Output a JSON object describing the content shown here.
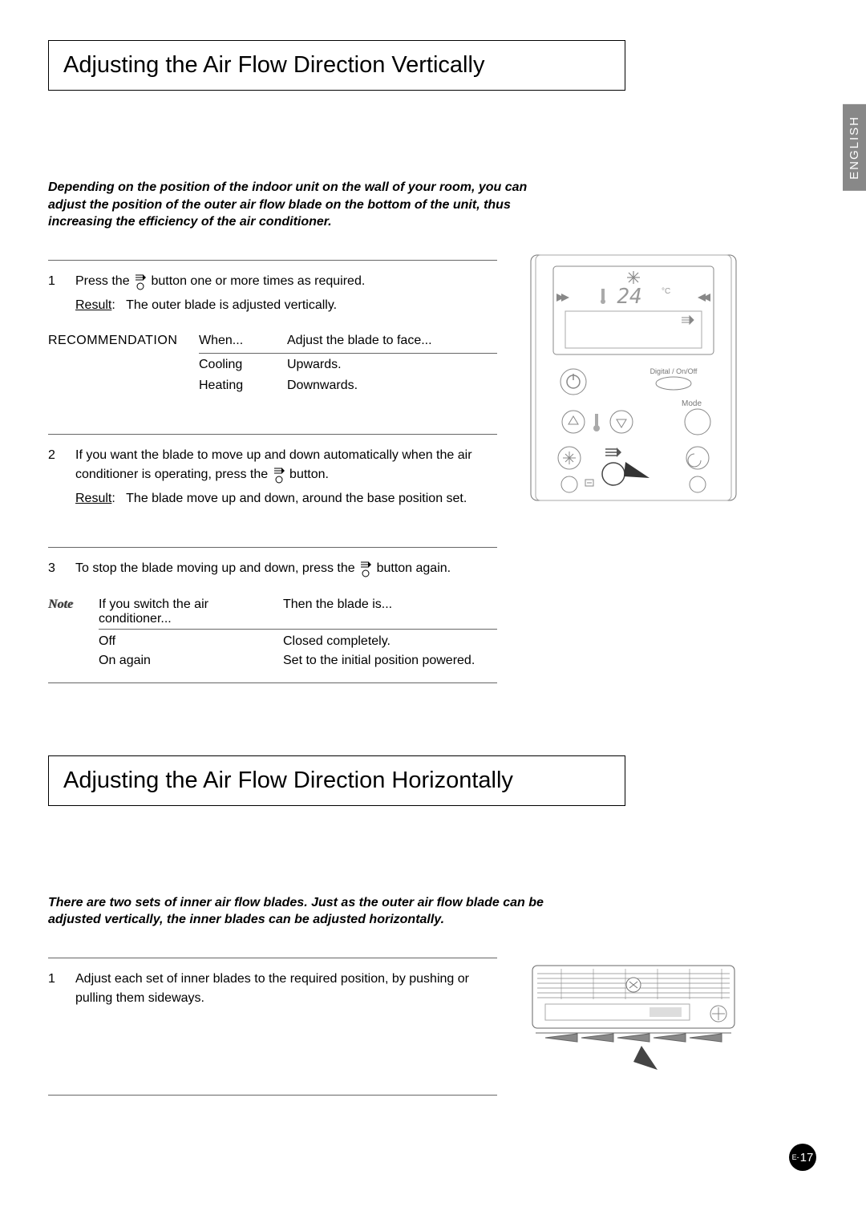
{
  "lang_tab": "ENGLISH",
  "section1": {
    "title": "Adjusting the Air Flow Direction Vertically",
    "intro": "Depending on the position of the indoor unit on the wall of your room, you can adjust the position of the outer air flow blade on the bottom of the unit, thus increasing the efficiency of the air conditioner.",
    "step1_a": "Press the ",
    "step1_b": " button one or more times as required.",
    "result_label": "Result",
    "step1_result": "The outer blade is adjusted vertically.",
    "rec_label": "RECOMMENDATION",
    "rec_head_when": "When...",
    "rec_head_adjust": "Adjust the blade to face...",
    "rec_rows": [
      {
        "when": "Cooling",
        "adjust": "Upwards."
      },
      {
        "when": "Heating",
        "adjust": "Downwards."
      }
    ],
    "step2_a": "If you want the blade to move up and down automatically when the air conditioner is operating, press the ",
    "step2_b": " button.",
    "step2_result": "The blade move up and down, around the base position set.",
    "step3_a": "To stop the blade moving up and down, press the ",
    "step3_b": " button again.",
    "note_label": "Note",
    "note_head_if": "If you switch the air conditioner...",
    "note_head_then": "Then the blade is...",
    "note_rows": [
      {
        "if": "Off",
        "then": "Closed completely."
      },
      {
        "if": "On again",
        "then": "Set to the initial position powered."
      }
    ]
  },
  "section2": {
    "title": "Adjusting the Air Flow Direction Horizontally",
    "intro": "There are two sets of inner air flow blades. Just as the outer air flow blade can be adjusted vertically, the inner blades can be adjusted horizontally.",
    "step1": "Adjust each set of inner blades to the required position, by pushing or pulling them sideways."
  },
  "remote": {
    "display_temp": "24",
    "digital_label": "Digital / On/Off",
    "mode_label": "Mode"
  },
  "page_prefix": "E-",
  "page_number": "17"
}
